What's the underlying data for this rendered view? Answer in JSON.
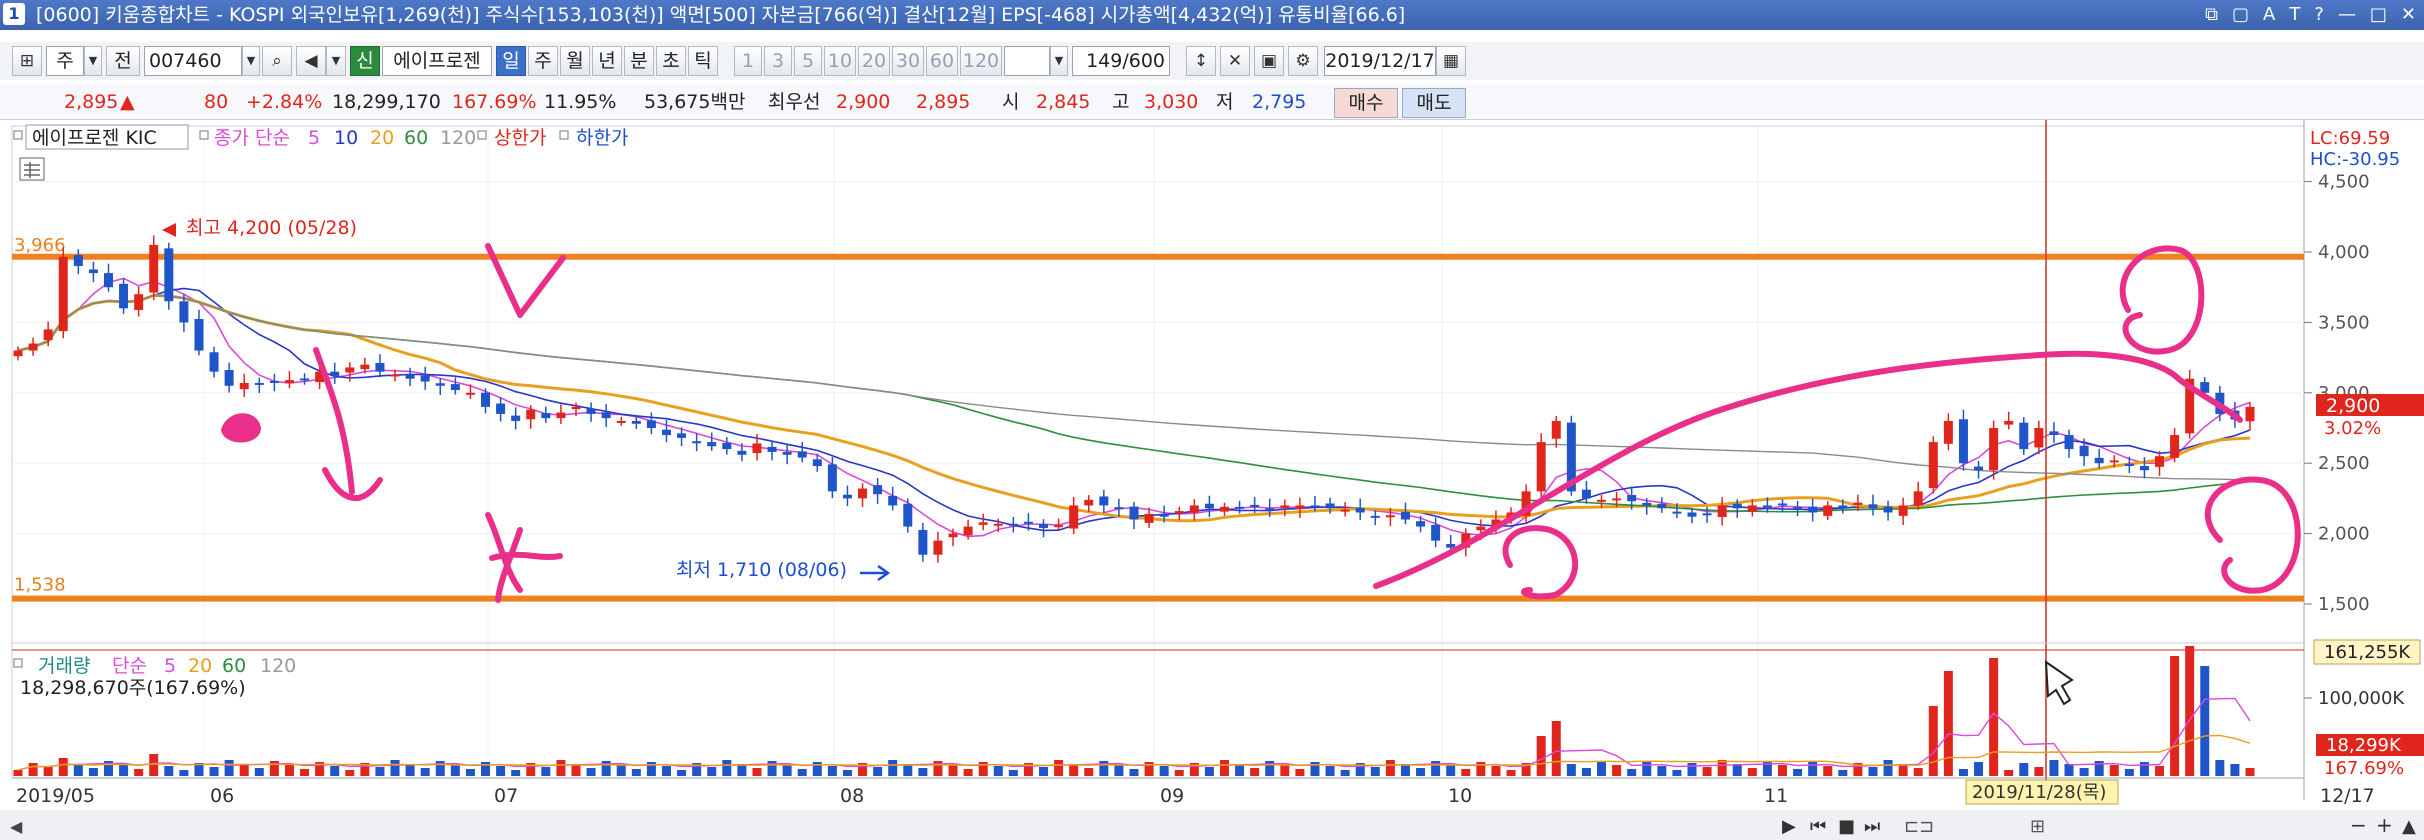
{
  "window": {
    "number": "1",
    "title": "[0600] 키움종합차트 - KOSPI 외국인보유[1,269(천)] 주식수[153,103(천)] 액면[500] 자본금[766(억)] 결산[12월] EPS[-468] 시가총액[4,432(억)] 유통비율[66.6]",
    "controls": [
      "⧉",
      "▢",
      "A",
      "T",
      "?",
      "—",
      "□",
      "✕"
    ]
  },
  "toolbar": {
    "period_type": "주",
    "prev_label": "전",
    "stock_code": "007460",
    "new_badge": "신",
    "stock_name": "에이프로젠",
    "period_buttons": [
      "일",
      "주",
      "월",
      "년",
      "분",
      "초",
      "틱"
    ],
    "minute_buttons": [
      "1",
      "3",
      "5",
      "10",
      "20",
      "30",
      "60",
      "120"
    ],
    "count": "149/600",
    "date": "2019/12/17"
  },
  "quote": {
    "price": "2,895",
    "arrow": "▲",
    "change": "80",
    "change_pct": "+2.84%",
    "volume": "18,299,170",
    "volume_ratio": "167.69%",
    "turnover": "11.95%",
    "amount": "53,675백만",
    "best_ask_label": "최우선",
    "best_ask": "2,900",
    "best_bid": "2,895",
    "open_label": "시",
    "open": "2,845",
    "high_label": "고",
    "high": "3,030",
    "low_label": "저",
    "low": "2,795",
    "buy_label": "매수",
    "sell_label": "매도"
  },
  "legend": {
    "name": "에이프로젠 KIC",
    "ma_prefix": "종가 단순",
    "ma_periods": [
      "5",
      "10",
      "20",
      "60",
      "120"
    ],
    "upper_limit": "상한가",
    "lower_limit": "하한가"
  },
  "volume_legend": {
    "label": "거래량",
    "ma_prefix": "단순",
    "ma_periods": [
      "5",
      "20",
      "60",
      "120"
    ],
    "value": "18,298,670주(167.69%)"
  },
  "right_info": {
    "lc": "LC:69.59",
    "hc": "HC:-30.95"
  },
  "annotations": {
    "high": "최고 4,200 (05/28)",
    "low": "최저 1,710 (08/06)",
    "upper_line": "3,966",
    "lower_line": "1,538",
    "price_box": "2,900",
    "pct_box": "3.02%",
    "vol_box": "161,255K",
    "cur_vol_box": "18,299K",
    "cur_vol_pct": "167.69%",
    "cursor_date": "2019/11/28(목)"
  },
  "colors": {
    "up": "#e0261c",
    "down": "#1f55c9",
    "ma5": "#d94ad9",
    "ma10": "#2737c8",
    "ma20": "#e8a020",
    "ma60": "#2e8f3c",
    "ma120": "#8a8a8a",
    "hline": "#f0801e",
    "pen": "#ea2f8a"
  },
  "chart_data": {
    "type": "candlestick",
    "period": "daily",
    "price_axis_ticks": [
      "4,500",
      "4,000",
      "3,500",
      "3,000",
      "2,500",
      "2,000",
      "1,500"
    ],
    "volume_axis_ticks": [
      "100,000K"
    ],
    "x_ticks": [
      "2019/05",
      "06",
      "07",
      "08",
      "09",
      "10",
      "11",
      "12/17"
    ],
    "horizontal_lines": [
      3966,
      1538
    ],
    "closes": [
      3300,
      3350,
      3450,
      3966,
      3900,
      3850,
      3750,
      3600,
      3700,
      4050,
      3650,
      3500,
      3300,
      3150,
      3050,
      3070,
      3060,
      3080,
      3090,
      3100,
      3150,
      3120,
      3180,
      3200,
      3150,
      3130,
      3100,
      3080,
      3050,
      3020,
      3000,
      2900,
      2850,
      2800,
      2880,
      2820,
      2860,
      2900,
      2850,
      2820,
      2800,
      2780,
      2750,
      2700,
      2680,
      2650,
      2620,
      2600,
      2560,
      2640,
      2580,
      2560,
      2540,
      2480,
      2300,
      2250,
      2320,
      2280,
      2200,
      2050,
      1850,
      1950,
      2000,
      2050,
      2080,
      2070,
      2060,
      2080,
      2040,
      2060,
      2200,
      2240,
      2200,
      2180,
      2100,
      2140,
      2120,
      2160,
      2200,
      2180,
      2190,
      2180,
      2190,
      2170,
      2200,
      2200,
      2190,
      2180,
      2170,
      2150,
      2120,
      2130,
      2100,
      2050,
      1950,
      1900,
      2000,
      2050,
      2100,
      2150,
      2300,
      2650,
      2800,
      2300,
      2250,
      2240,
      2250,
      2230,
      2200,
      2180,
      2150,
      2120,
      2130,
      2200,
      2180,
      2200,
      2190,
      2200,
      2180,
      2150,
      2200,
      2180,
      2220,
      2180,
      2150,
      2200,
      2300,
      2650,
      2800,
      2500,
      2450,
      2750,
      2800,
      2600,
      2750,
      2700,
      2600,
      2550,
      2500,
      2520,
      2480,
      2450,
      2550,
      2700,
      3100,
      3000,
      2850,
      2810,
      2900
    ]
  }
}
